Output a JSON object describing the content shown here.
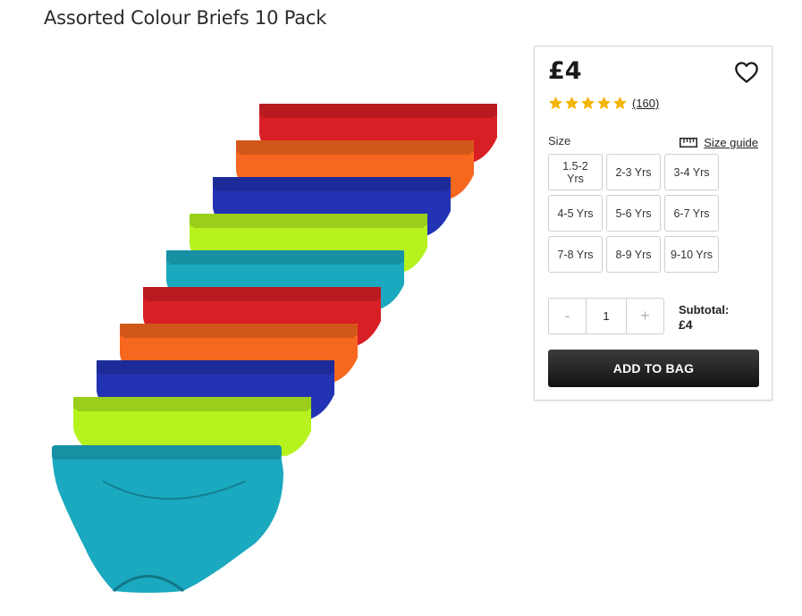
{
  "product": {
    "title": "Assorted Colour Briefs 10 Pack",
    "price": "£4",
    "rating": 5,
    "review_count": "(160)",
    "image_icon": "briefs-10-pack-image",
    "image_colors": [
      "#d91f26",
      "#f6681f",
      "#2233b4",
      "#b5f21e",
      "#1aa9bf",
      "#d91f26",
      "#f6681f",
      "#2233b4",
      "#b5f21e",
      "#1aa9bf"
    ]
  },
  "wishlist": {
    "icon": "heart-icon"
  },
  "size": {
    "label": "Size",
    "guide_label": "Size guide",
    "guide_icon": "ruler-icon",
    "options": [
      "1.5-2 Yrs",
      "2-3 Yrs",
      "3-4 Yrs",
      "4-5 Yrs",
      "5-6 Yrs",
      "6-7 Yrs",
      "7-8 Yrs",
      "8-9 Yrs",
      "9-10 Yrs"
    ]
  },
  "quantity": {
    "decrement": "-",
    "value": "1",
    "increment": "+"
  },
  "subtotal": {
    "label": "Subtotal:",
    "value": "£4"
  },
  "cta": {
    "add_to_bag": "ADD TO BAG"
  },
  "colors": {
    "star": "#f4b400",
    "button": "#1a1a1a"
  }
}
